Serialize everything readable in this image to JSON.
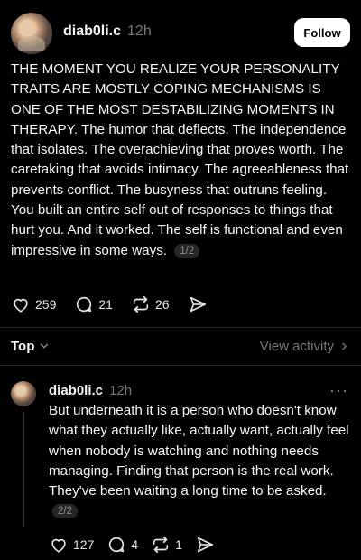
{
  "main_post": {
    "username": "diab0li.c",
    "time": "12h",
    "follow_label": "Follow",
    "text": "THE MOMENT YOU REALIZE YOUR PERSONALITY TRAITS ARE MOSTLY COPING MECHANISMS IS ONE OF THE MOST DESTABILIZING MOMENTS IN THERAPY. The humor that deflects. The independence that isolates. The overachieving that proves worth. The caretaking that avoids intimacy. The agreeableness that prevents conflict. The busyness that outruns feeling. You built an entire self out of responses to things that hurt you. And it worked. The self is functional and even impressive in some ways.",
    "pager": "1/2",
    "likes": "259",
    "comments": "21",
    "reposts": "26"
  },
  "sort": {
    "label": "Top",
    "view_activity": "View activity"
  },
  "reply": {
    "username": "diab0li.c",
    "time": "12h",
    "more": "···",
    "text": "But underneath it is a person who doesn't know what they actually like, actually want, actually feel when nobody is watching and nothing needs managing. Finding that person is the real work. They've been waiting a long time to be asked.",
    "pager": "2/2",
    "likes": "127",
    "comments": "4",
    "reposts": "1"
  },
  "colors": {
    "background": "#000000",
    "text": "#f3f5f7",
    "muted": "#777777",
    "divider": "#262626"
  },
  "icons": [
    "heart-icon",
    "comment-icon",
    "repost-icon",
    "share-icon",
    "chevron-down-icon",
    "chevron-right-icon",
    "more-icon"
  ]
}
